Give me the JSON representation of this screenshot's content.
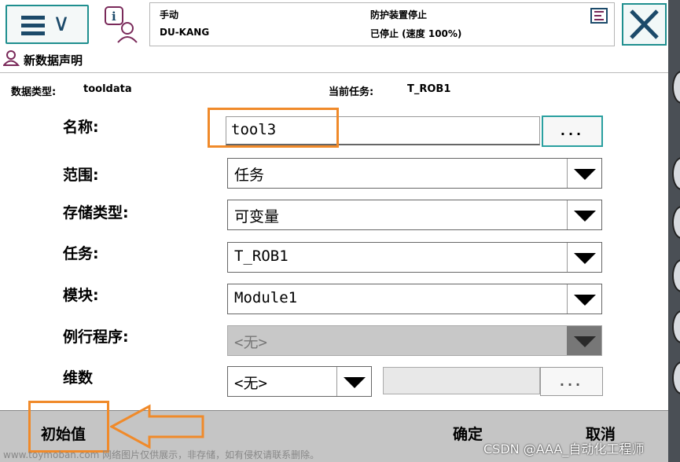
{
  "header": {
    "mode": "手动",
    "controller": "DU-KANG",
    "safety_status": "防护装置停止",
    "run_status": "已停止 (速度 100%)"
  },
  "title": "新数据声明",
  "info": {
    "datatype_label": "数据类型:",
    "datatype_value": "tooldata",
    "task_label": "当前任务:",
    "task_value": "T_ROB1"
  },
  "form": {
    "name_label": "名称:",
    "name_value": "tool3",
    "name_button": "...",
    "scope_label": "范围:",
    "scope_value": "任务",
    "storage_label": "存储类型:",
    "storage_value": "可变量",
    "task_label": "任务:",
    "task_value": "T_ROB1",
    "module_label": "模块:",
    "module_value": "Module1",
    "routine_label": "例行程序:",
    "routine_value": "<无>",
    "dim_label": "维数",
    "dim_value": "<无>",
    "dim_button": "..."
  },
  "bottom": {
    "initial_value": "初始值",
    "ok": "确定",
    "cancel": "取消"
  },
  "footer": "www.toymoban.com 网络图片仅供展示，非存储，如有侵权请联系删除。",
  "watermark": "CSDN @AAA_自动化工程师",
  "colors": {
    "accent": "#1f8f8f",
    "highlight": "#f08a2a",
    "bar": "#c5c5c5"
  }
}
